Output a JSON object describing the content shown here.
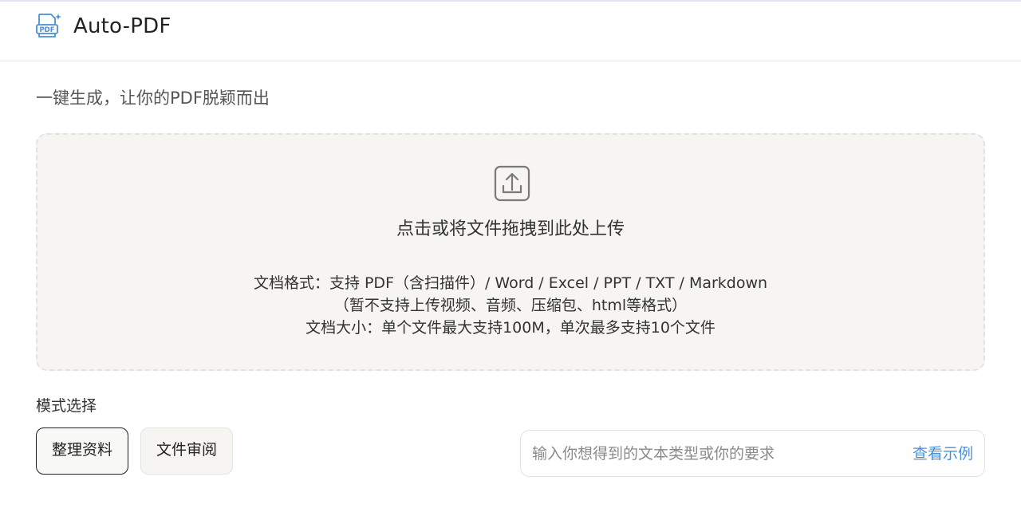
{
  "header": {
    "app_title": "Auto-PDF",
    "logo_icon": "pdf-file-sparkle-icon",
    "logo_text": "PDF"
  },
  "tagline": "一键生成，让你的PDF脱颖而出",
  "upload": {
    "icon": "upload-icon",
    "title": "点击或将文件拖拽到此处上传",
    "formats_line": "文档格式：支持 PDF（含扫描件）/ Word / Excel / PPT / TXT / Markdown",
    "unsupported_line": "（暂不支持上传视频、音频、压缩包、html等格式）",
    "size_line": "文档大小：单个文件最大支持100M，单次最多支持10个文件"
  },
  "mode": {
    "label": "模式选择",
    "options": [
      "整理资料",
      "文件审阅"
    ],
    "selected": "整理资料"
  },
  "prompt": {
    "placeholder": "输入你想得到的文本类型或你的要求",
    "value": "",
    "example_link": "查看示例"
  },
  "colors": {
    "accent_link": "#4a90d9",
    "logo_blue": "#4a8fd4",
    "dropzone_bg": "#f6f5f2"
  }
}
